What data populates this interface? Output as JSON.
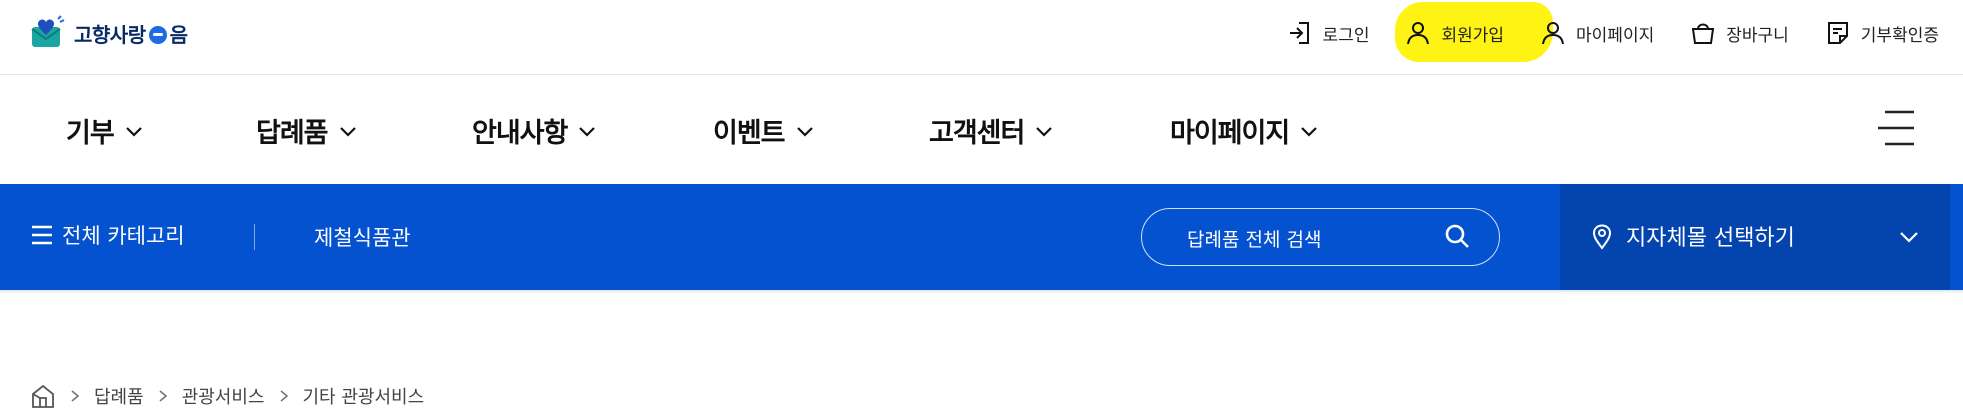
{
  "logo": {
    "text_before": "고향사랑",
    "text_after": "음"
  },
  "util_menu": [
    {
      "label": "로그인",
      "icon": "login-icon"
    },
    {
      "label": "회원가입",
      "icon": "user-icon"
    },
    {
      "label": "마이페이지",
      "icon": "user-icon"
    },
    {
      "label": "장바구니",
      "icon": "cart-icon"
    },
    {
      "label": "기부확인증",
      "icon": "certificate-icon"
    }
  ],
  "gnb": [
    {
      "label": "기부"
    },
    {
      "label": "답례품"
    },
    {
      "label": "안내사항"
    },
    {
      "label": "이벤트"
    },
    {
      "label": "고객센터"
    },
    {
      "label": "마이페이지"
    }
  ],
  "category_bar": {
    "all_category": "전체 카테고리",
    "shop_link": "제철식품관",
    "search_placeholder": "답례품 전체 검색",
    "region_select": "지자체몰 선택하기"
  },
  "breadcrumb": [
    "답례품",
    "관광서비스",
    "기타 관광서비스"
  ],
  "colors": {
    "primary_blue": "#0452cf",
    "region_blue": "#0444ae",
    "highlight": "#fff200"
  }
}
